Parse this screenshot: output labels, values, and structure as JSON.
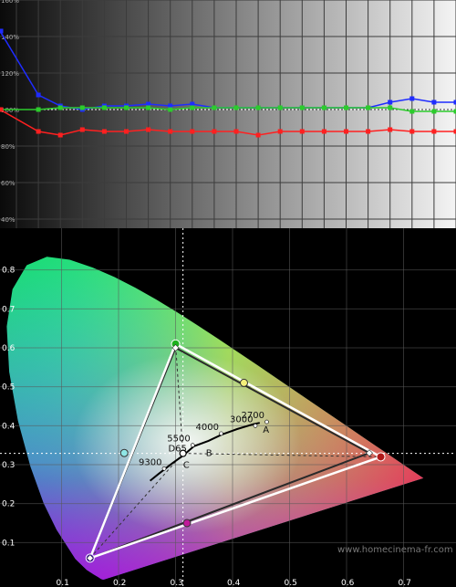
{
  "chart_data": [
    {
      "type": "line",
      "x": [
        0,
        1,
        2,
        3,
        4,
        5,
        6,
        7,
        8,
        9,
        10,
        11,
        12,
        13,
        14,
        15,
        16,
        17,
        18,
        19,
        20
      ],
      "yticks": [
        "160%",
        "140%",
        "120%",
        "100%",
        "80%",
        "60%",
        "40%"
      ],
      "ylim": [
        35,
        160
      ],
      "reference": 100,
      "series": [
        {
          "color": "#1f2cff",
          "values": [
            143,
            108,
            102,
            100,
            102,
            102,
            103,
            102,
            103,
            101,
            101,
            101,
            101,
            101,
            101,
            101,
            101,
            104,
            106,
            104,
            104
          ]
        },
        {
          "color": "#2ccc2c",
          "values": [
            100,
            100,
            101,
            101,
            101,
            101,
            101,
            100,
            101,
            101,
            101,
            101,
            101,
            101,
            101,
            101,
            101,
            101,
            99,
            99,
            99
          ]
        },
        {
          "color": "#ff2020",
          "values": [
            100,
            88,
            86,
            89,
            88,
            88,
            89,
            88,
            88,
            88,
            88,
            86,
            88,
            88,
            88,
            88,
            88,
            89,
            88,
            88,
            88
          ]
        }
      ]
    },
    {
      "type": "scatter",
      "xticks": [
        "0.1",
        "0.2",
        "0.3",
        "0.4",
        "0.5",
        "0.6",
        "0.7"
      ],
      "yticks": [
        "0.8",
        "0.7",
        "0.6",
        "0.5",
        "0.4",
        "0.3",
        "0.2",
        "0.1"
      ],
      "xlim": [
        0.0,
        0.8
      ],
      "ylim": [
        0.0,
        0.9
      ],
      "reference_gamut": {
        "red": [
          0.64,
          0.33
        ],
        "green": [
          0.3,
          0.6
        ],
        "blue": [
          0.15,
          0.06
        ]
      },
      "measured_gamut": {
        "red": [
          0.66,
          0.32
        ],
        "green": [
          0.3,
          0.61
        ],
        "blue": [
          0.15,
          0.06
        ]
      },
      "measured_secondaries": {
        "cyan": [
          0.21,
          0.33
        ],
        "magenta": [
          0.32,
          0.15
        ],
        "yellow": [
          0.42,
          0.51
        ]
      },
      "white_point_measured": [
        0.313,
        0.329
      ],
      "planckian_labels": [
        {
          "text": "2700",
          "x": 0.46,
          "y": 0.41
        },
        {
          "text": "3000",
          "x": 0.44,
          "y": 0.4
        },
        {
          "text": "4000",
          "x": 0.38,
          "y": 0.38
        },
        {
          "text": "5500",
          "x": 0.33,
          "y": 0.35
        },
        {
          "text": "9300",
          "x": 0.28,
          "y": 0.29
        }
      ],
      "illuminant_labels": [
        {
          "text": "A",
          "x": 0.45,
          "y": 0.41
        },
        {
          "text": "B",
          "x": 0.35,
          "y": 0.35
        },
        {
          "text": "C",
          "x": 0.31,
          "y": 0.32
        },
        {
          "text": "D65",
          "x": 0.3127,
          "y": 0.329
        }
      ],
      "watermark": "www.homecinema-fr.com"
    }
  ]
}
